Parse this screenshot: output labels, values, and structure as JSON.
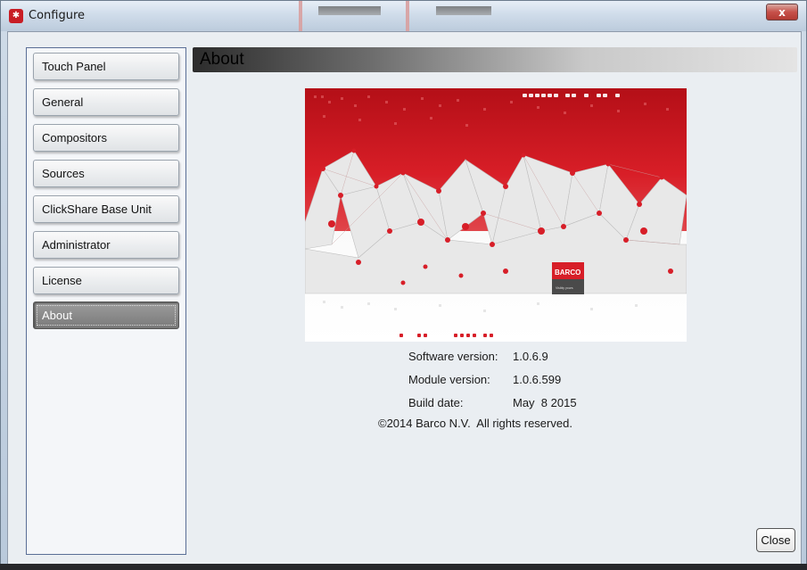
{
  "window": {
    "title": "Configure",
    "close_glyph": "x",
    "app_icon": "barco-configure-icon"
  },
  "sidebar": {
    "items": [
      {
        "label": "Touch Panel"
      },
      {
        "label": "General"
      },
      {
        "label": "Compositors"
      },
      {
        "label": "Sources"
      },
      {
        "label": "ClickShare Base Unit"
      },
      {
        "label": "Administrator"
      },
      {
        "label": "License"
      },
      {
        "label": "About",
        "active": true
      }
    ]
  },
  "main": {
    "title": "About",
    "splash": {
      "brand_logo": "BARCO",
      "brand_tagline": "Visibly yours"
    },
    "info": {
      "software_label": "Software version:",
      "software_value": "1.0.6.9",
      "module_label": "Module version:",
      "module_value": "1.0.6.599",
      "build_label": "Build date:",
      "build_value": "May  8 2015",
      "copyright": "©2014 Barco N.V.  All rights reserved."
    },
    "close_label": "Close"
  },
  "colors": {
    "accent_red": "#d4202b",
    "active_item": "#8a8a8a"
  }
}
